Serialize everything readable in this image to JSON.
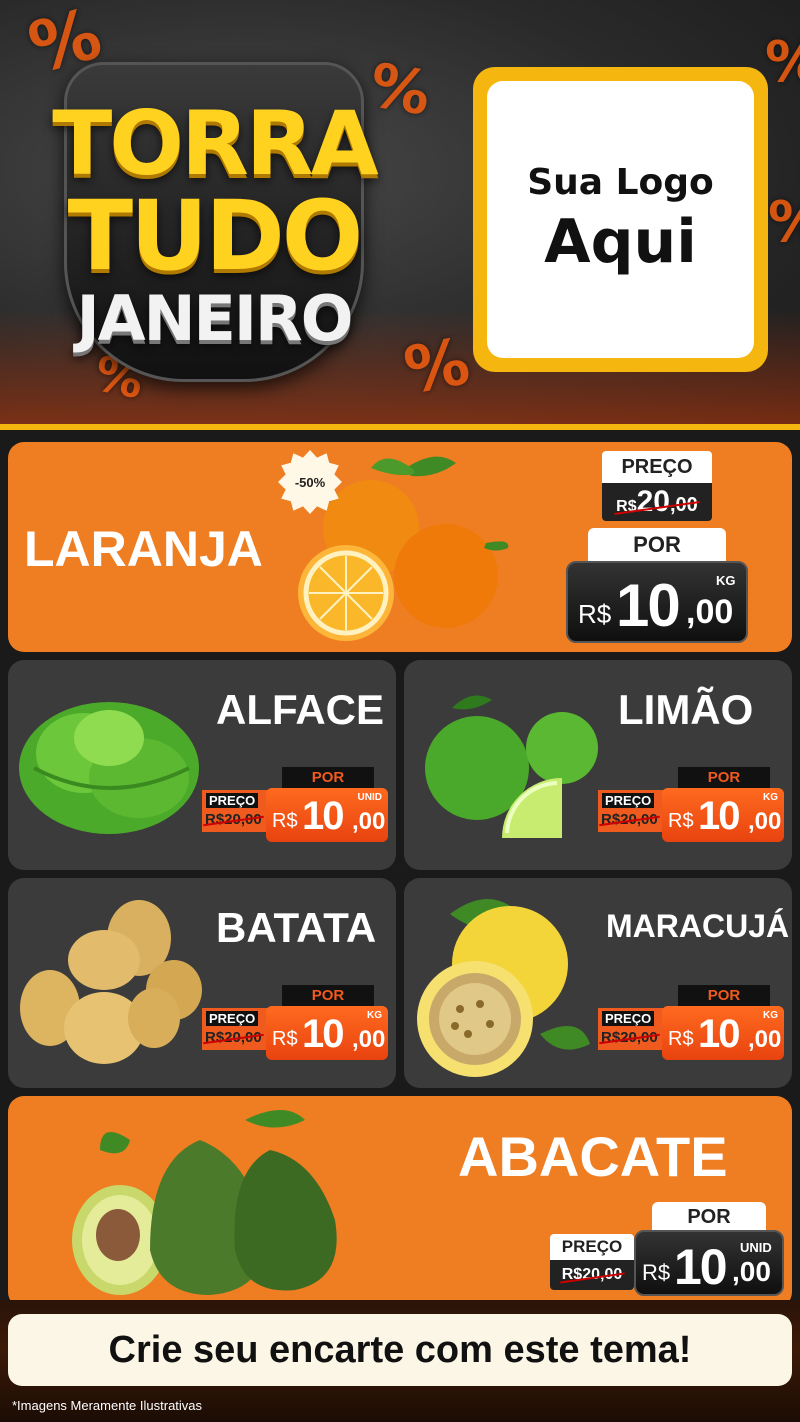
{
  "header": {
    "badge_line1": "TORRA",
    "badge_line2": "TUDO",
    "badge_line3": "JANEIRO",
    "logo_line1": "Sua Logo",
    "logo_line2": "Aqui",
    "percent_symbol": "%"
  },
  "colors": {
    "orange": "#ef7d22",
    "dark_card": "#3b3b3b",
    "accent_yellow": "#f5b70f",
    "price_orange": "#ef5a1e"
  },
  "laranja": {
    "name": "LARANJA",
    "discount": "-50%",
    "preco_label": "PREÇO",
    "old_currency": "R$",
    "old_value": "20",
    "old_cents": ",00",
    "por_label": "POR",
    "currency": "R$",
    "value": "10",
    "cents": ",00",
    "unit": "KG"
  },
  "alface": {
    "name": "ALFACE",
    "por_label": "POR",
    "preco_label": "PREÇO",
    "old_price": "R$20,00",
    "currency": "R$",
    "value": "10",
    "cents": ",00",
    "unit": "UNID"
  },
  "limao": {
    "name": "LIMÃO",
    "por_label": "POR",
    "preco_label": "PREÇO",
    "old_price": "R$20,00",
    "currency": "R$",
    "value": "10",
    "cents": ",00",
    "unit": "KG"
  },
  "batata": {
    "name": "BATATA",
    "por_label": "POR",
    "preco_label": "PREÇO",
    "old_price": "R$20,00",
    "currency": "R$",
    "value": "10",
    "cents": ",00",
    "unit": "KG"
  },
  "maracuja": {
    "name": "MARACUJÁ",
    "por_label": "POR",
    "preco_label": "PREÇO",
    "old_price": "R$20,00",
    "currency": "R$",
    "value": "10",
    "cents": ",00",
    "unit": "KG"
  },
  "abacate": {
    "name": "ABACATE",
    "por_label": "POR",
    "preco_label": "PREÇO",
    "old_price": "R$20,00",
    "currency": "R$",
    "value": "10",
    "cents": ",00",
    "unit": "UNID"
  },
  "footer": {
    "cta": "Crie seu encarte com este tema!",
    "disclaimer": "*Imagens Meramente Ilustrativas"
  }
}
